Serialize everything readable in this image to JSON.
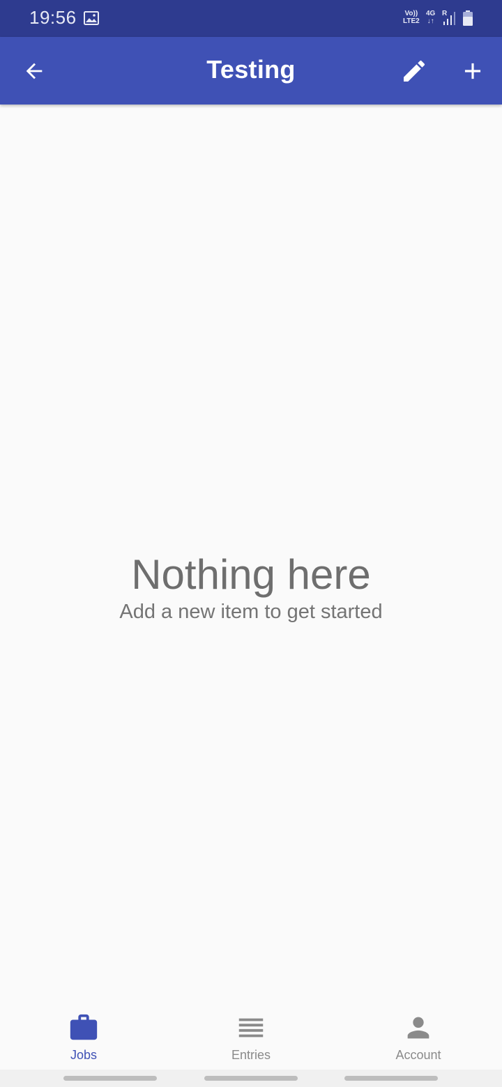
{
  "status_bar": {
    "time": "19:56",
    "network_top": "Vo))",
    "network_bottom": "LTE2",
    "data_type": "4G",
    "data_arrows": "↓↑",
    "roaming": "R",
    "icons": [
      "image-icon",
      "signal-icon",
      "battery-icon"
    ]
  },
  "app_bar": {
    "title": "Testing",
    "back_icon": "arrow-left-icon",
    "edit_icon": "pencil-icon",
    "add_icon": "plus-icon",
    "color": "#3f51b5"
  },
  "empty_state": {
    "title": "Nothing here",
    "subtitle": "Add a new item to get started"
  },
  "bottom_nav": {
    "items": [
      {
        "label": "Jobs",
        "icon": "briefcase-icon",
        "active": true
      },
      {
        "label": "Entries",
        "icon": "list-icon",
        "active": false
      },
      {
        "label": "Account",
        "icon": "person-icon",
        "active": false
      }
    ],
    "active_color": "#3f51b5",
    "inactive_color": "#8a8a8a"
  }
}
